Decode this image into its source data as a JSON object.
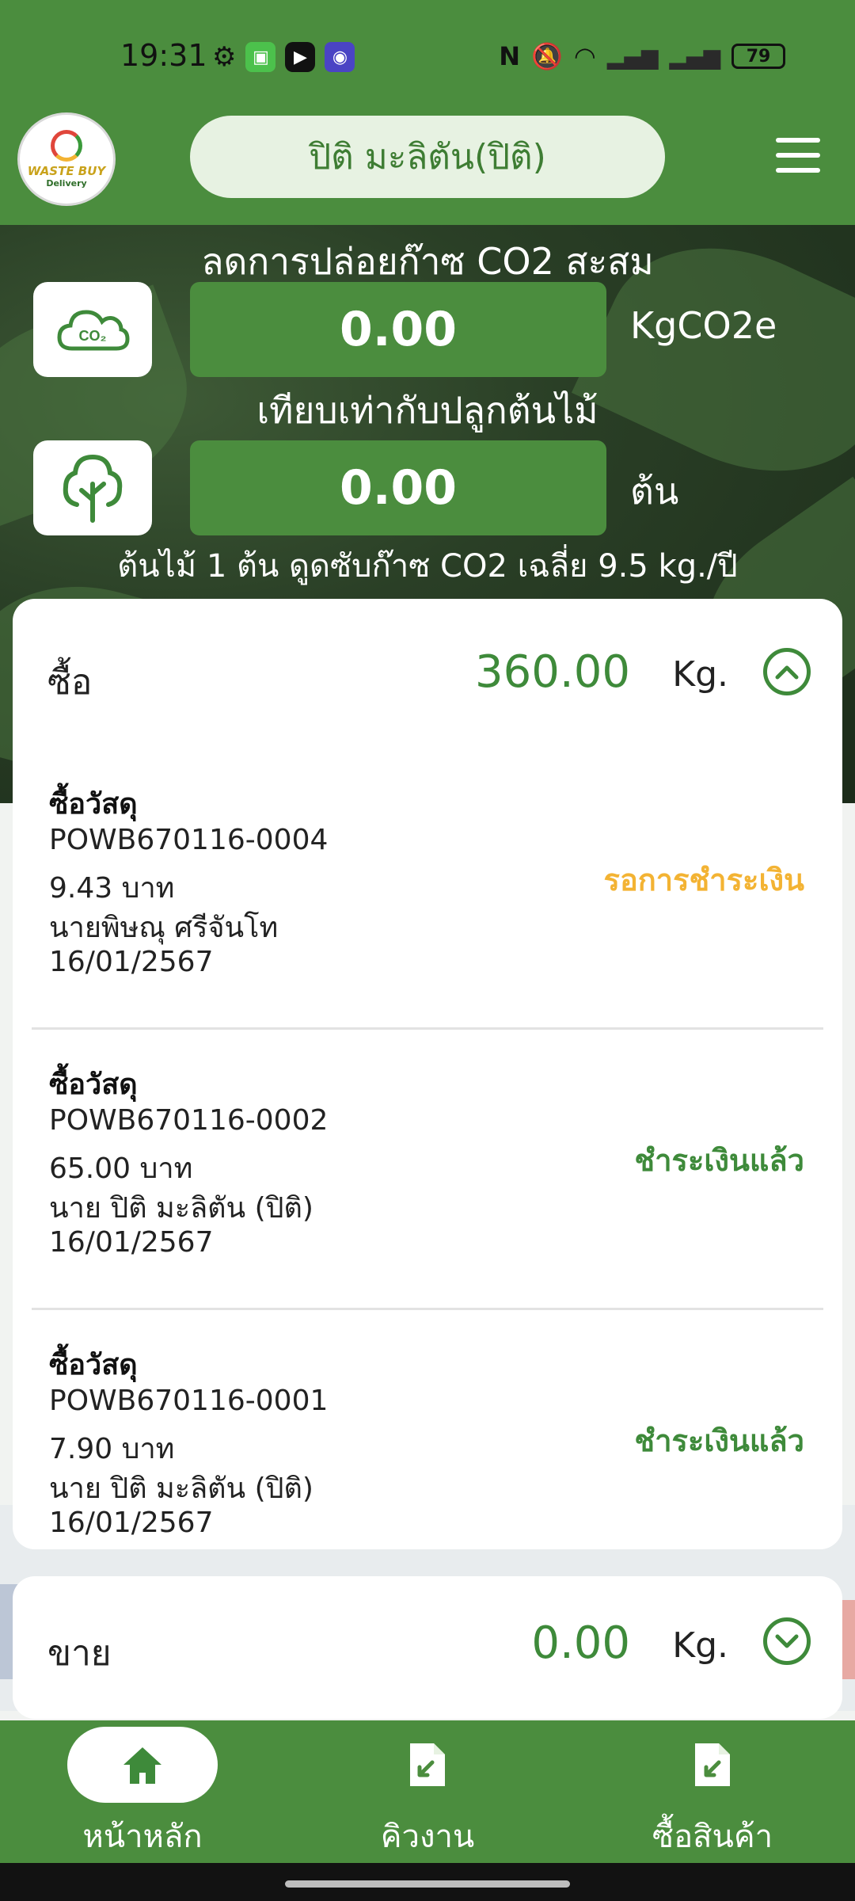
{
  "status_bar": {
    "time": "19:31",
    "battery": "79"
  },
  "header": {
    "user_name": "ปิติ มะลิตัน(ปิติ)",
    "logo_text": "WASTE BUY",
    "logo_sub": "Delivery"
  },
  "hero": {
    "co2_title": "ลดการปล่อยก๊าซ CO2 สะสม",
    "co2_value": "0.00",
    "co2_unit": "KgCO2e",
    "co2_icon_label": "CO₂",
    "tree_title": "เทียบเท่ากับปลูกต้นไม้",
    "tree_value": "0.00",
    "tree_unit": "ต้น",
    "note": "ต้นไม้ 1 ต้น ดูดซับก๊าซ CO2 เฉลี่ย 9.5 kg./ปี"
  },
  "buy": {
    "label": "ซื้อ",
    "amount": "360.00",
    "unit": "Kg.",
    "items": [
      {
        "title": "ซื้อวัสดุ",
        "code": "POWB670116-0004",
        "price": "9.43 บาท",
        "name": "นายพิษณุ ศรีจันโท",
        "date": "16/01/2567",
        "status": "รอการชำระเงิน",
        "status_color": "#f3b333"
      },
      {
        "title": "ซื้อวัสดุ",
        "code": "POWB670116-0002",
        "price": "65.00 บาท",
        "name": "นาย ปิติ มะลิตัน (ปิติ)",
        "date": "16/01/2567",
        "status": "ชำระเงินแล้ว",
        "status_color": "#3e8a3a"
      },
      {
        "title": "ซื้อวัสดุ",
        "code": "POWB670116-0001",
        "price": "7.90 บาท",
        "name": "นาย ปิติ มะลิตัน (ปิติ)",
        "date": "16/01/2567",
        "status": "ชำระเงินแล้ว",
        "status_color": "#3e8a3a"
      }
    ]
  },
  "sell": {
    "label": "ขาย",
    "amount": "0.00",
    "unit": "Kg."
  },
  "nav": {
    "home": "หน้าหลัก",
    "queue": "คิวงาน",
    "buy_product": "ซื้อสินค้า"
  },
  "colors": {
    "brand_green": "#4b8d3e",
    "pending": "#f3b333",
    "paid": "#3e8a3a"
  }
}
